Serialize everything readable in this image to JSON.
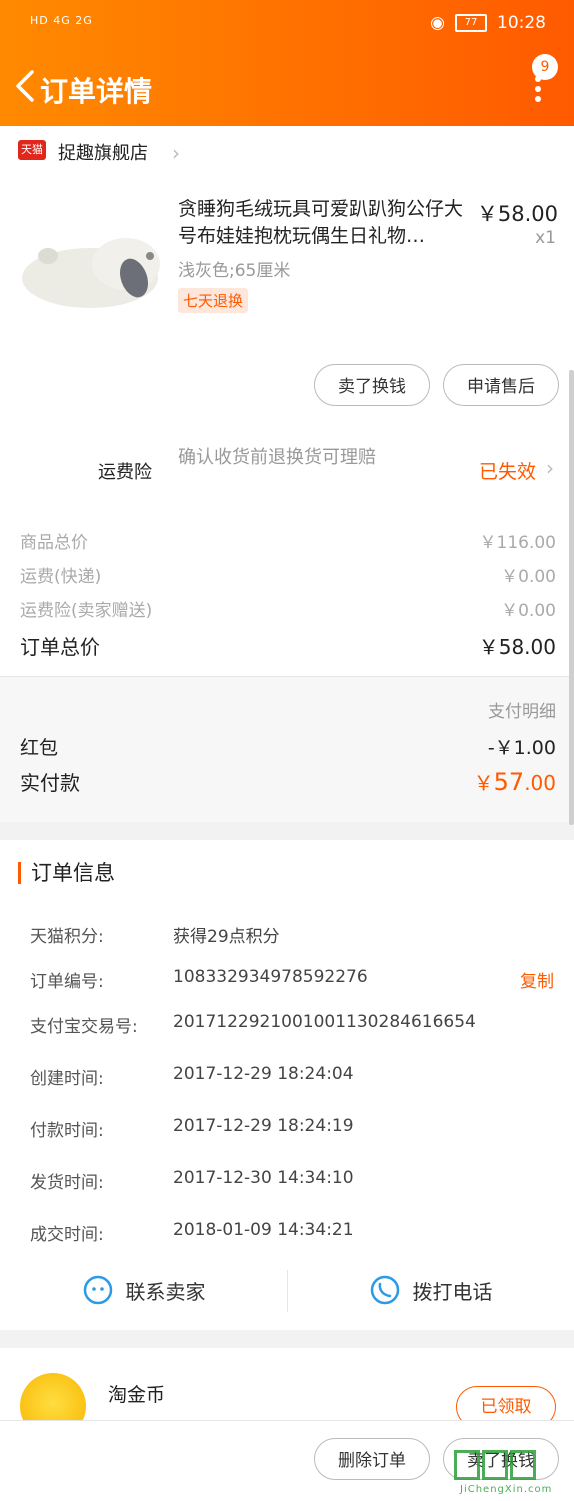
{
  "status_bar": {
    "network": "HD 4G 2G",
    "battery": "77",
    "time": "10:28"
  },
  "header": {
    "title": "订单详情",
    "badge": "9"
  },
  "shop": {
    "logo_text": "天猫",
    "name": "捉趣旗舰店"
  },
  "product": {
    "title": "贪睡狗毛绒玩具可爱趴趴狗公仔大号布娃娃抱枕玩偶生日礼物…",
    "price": "￥58.00",
    "qty": "x1",
    "spec": "浅灰色;65厘米",
    "tag": "七天退换",
    "btn_sell": "卖了换钱",
    "btn_after_sale": "申请售后"
  },
  "insurance": {
    "label": "运费险",
    "desc": "确认收货前退换货可理赔",
    "status": "已失效"
  },
  "summary": {
    "items": [
      {
        "label": "商品总价",
        "value": "￥116.00"
      },
      {
        "label": "运费(快递)",
        "value": "￥0.00"
      },
      {
        "label": "运费险(卖家赠送)",
        "value": "￥0.00"
      }
    ],
    "total_label": "订单总价",
    "total_value": "￥58.00"
  },
  "payment": {
    "detail_label": "支付明细",
    "redpacket_label": "红包",
    "redpacket_value": "-￥1.00",
    "actual_label": "实付款",
    "actual_currency": "￥",
    "actual_int": "57",
    "actual_dec": ".00"
  },
  "order_info": {
    "title": "订单信息",
    "rows": [
      {
        "label": "天猫积分:",
        "value": "获得29点积分"
      },
      {
        "label": "订单编号:",
        "value": "108332934978592276"
      },
      {
        "label": "支付宝交易号:",
        "value": "2017122921001001130284616654"
      },
      {
        "label": "创建时间:",
        "value": "2017-12-29 18:24:04"
      },
      {
        "label": "付款时间:",
        "value": "2017-12-29 18:24:19"
      },
      {
        "label": "发货时间:",
        "value": "2017-12-30 14:34:10"
      },
      {
        "label": "成交时间:",
        "value": "2018-01-09 14:34:21"
      }
    ],
    "copy_label": "复制",
    "contact_seller": "联系卖家",
    "call_phone": "拨打电话"
  },
  "coin": {
    "label": "淘金币",
    "claimed": "已领取"
  },
  "bottom": {
    "delete_order": "删除订单",
    "sell": "卖了换钱"
  },
  "watermark": {
    "url": "JiChengXin.com"
  },
  "colors": {
    "accent": "#ff5a00",
    "gradient_start": "#ff8a00"
  }
}
